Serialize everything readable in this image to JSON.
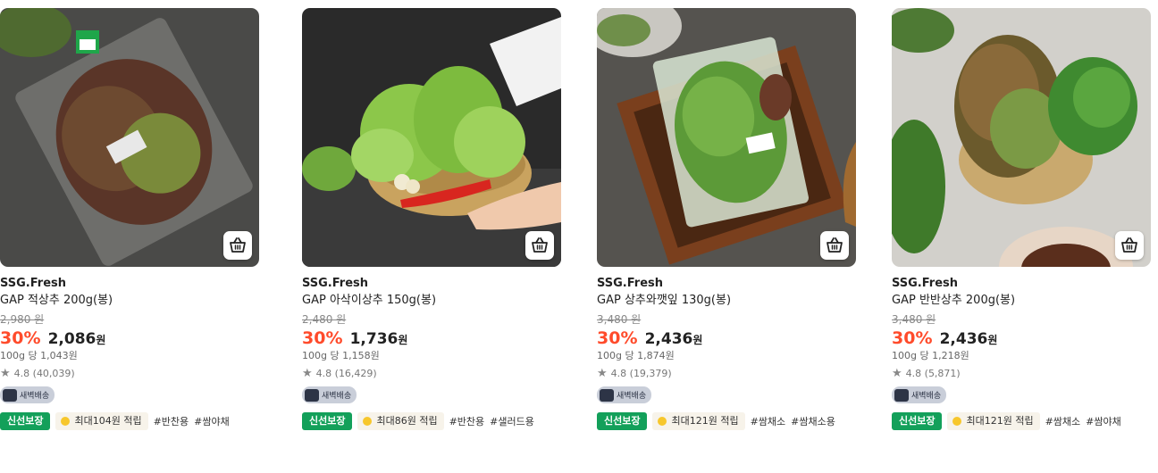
{
  "products": [
    {
      "brand": "SSG.Fresh",
      "name": "GAP 아삭이상추 150g(봉)",
      "original_price": "2,480 원",
      "discount": "30%",
      "sale_price": "1,736",
      "currency": "원",
      "unit_price": "100g 당 1,158원",
      "rating": "4.8 (16,429)",
      "delivery": "새벽배송",
      "fresh_badge": "신선보장",
      "points": "최대86원 적립",
      "hashtags": [
        "#반찬용",
        "#샐러드용"
      ],
      "image_icon": "lettuce-basket-photo"
    },
    {
      "brand": "SSG.Fresh",
      "name": "GAP 상추와깻잎 130g(봉)",
      "original_price": "3,480 원",
      "discount": "30%",
      "sale_price": "2,436",
      "currency": "원",
      "unit_price": "100g 당 1,874원",
      "rating": "4.8 (19,379)",
      "delivery": "새벽배송",
      "fresh_badge": "신선보장",
      "points": "최대121원 적립",
      "hashtags": [
        "#쌈채소",
        "#쌈채소용"
      ],
      "image_icon": "packaged-greens-in-wooden-box-photo"
    },
    {
      "brand": "SSG.Fresh",
      "name": "GAP 반반상추 200g(봉)",
      "original_price": "3,480 원",
      "discount": "30%",
      "sale_price": "2,436",
      "currency": "원",
      "unit_price": "100g 당 1,218원",
      "rating": "4.8 (5,871)",
      "delivery": "새벽배송",
      "fresh_badge": "신선보장",
      "points": "최대121원 적립",
      "hashtags": [
        "#쌈채소",
        "#쌈야채"
      ],
      "image_icon": "red-green-lettuce-photo"
    },
    {
      "brand": "SSG.Fresh",
      "name": "GAP 적상추 200g(봉)",
      "original_price": "2,980 원",
      "discount": "30%",
      "sale_price": "2,086",
      "currency": "원",
      "unit_price": "100g 당 1,043원",
      "rating": "4.8 (40,039)",
      "delivery": "새벽배송",
      "fresh_badge": "신선보장",
      "points": "최대104원 적립",
      "hashtags": [
        "#반찬용",
        "#쌈야채"
      ],
      "image_icon": "red-lettuce-bag-photo"
    }
  ],
  "colors": {
    "discount": "#ff4b2b",
    "fresh_badge": "#13a05a",
    "point_bg": "#f7f3ea",
    "delivery_bg": "#c9ced9"
  }
}
